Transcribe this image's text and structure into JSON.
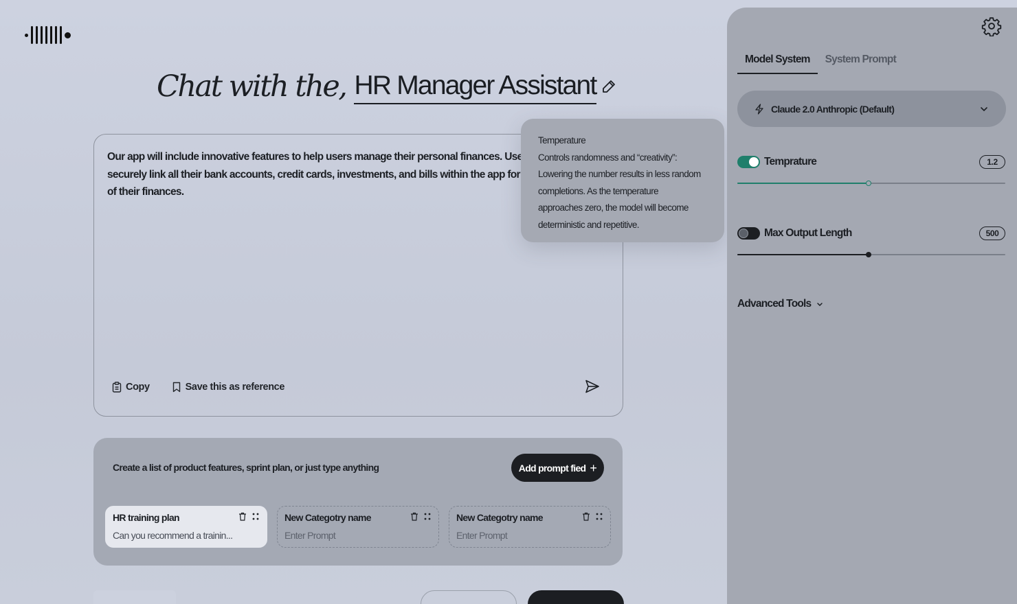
{
  "heading": {
    "prefix": "Chat with the,",
    "assistant_name": "HR Manager Assistant"
  },
  "editor": {
    "lines": [
      "Our app will include innovative features to help users manage their personal finances. Users",
      "securely link all their bank accounts, credit cards, investments, and bills within the app for a c",
      "of their finances."
    ],
    "copy_label": "Copy",
    "save_label": "Save this as reference"
  },
  "tooltip": {
    "title": "Temperature",
    "lines": [
      "Controls randomness and “creativity”:",
      "Lowering the number results in less random",
      "completions. As the temperature",
      "approaches zero, the model will become",
      "deterministic and repetitive."
    ]
  },
  "prompts": {
    "hint": "Create a list of product features, sprint plan, or just type anything",
    "add_button": "Add prompt fied",
    "cards": [
      {
        "name": "HR training plan",
        "prompt": "Can you recommend a trainin...",
        "active": true
      },
      {
        "name": "New Categotry name",
        "prompt": "Enter Prompt",
        "active": false
      },
      {
        "name": "New Categotry name",
        "prompt": "Enter Prompt",
        "active": false
      }
    ]
  },
  "panel": {
    "tabs": [
      "Model System",
      "System Prompt"
    ],
    "active_tab": 0,
    "model_label": "Claude 2.0 Anthropic (Default)",
    "temperature": {
      "label": "Temprature",
      "enabled": true,
      "value_text": "1.2",
      "level": 0.49,
      "accent": "#1f7f6b"
    },
    "max_output": {
      "label": "Max Output Length",
      "enabled": false,
      "value_text": "500",
      "level": 0.49,
      "accent": "#1c1e22"
    },
    "advanced_label": "Advanced Tools"
  }
}
